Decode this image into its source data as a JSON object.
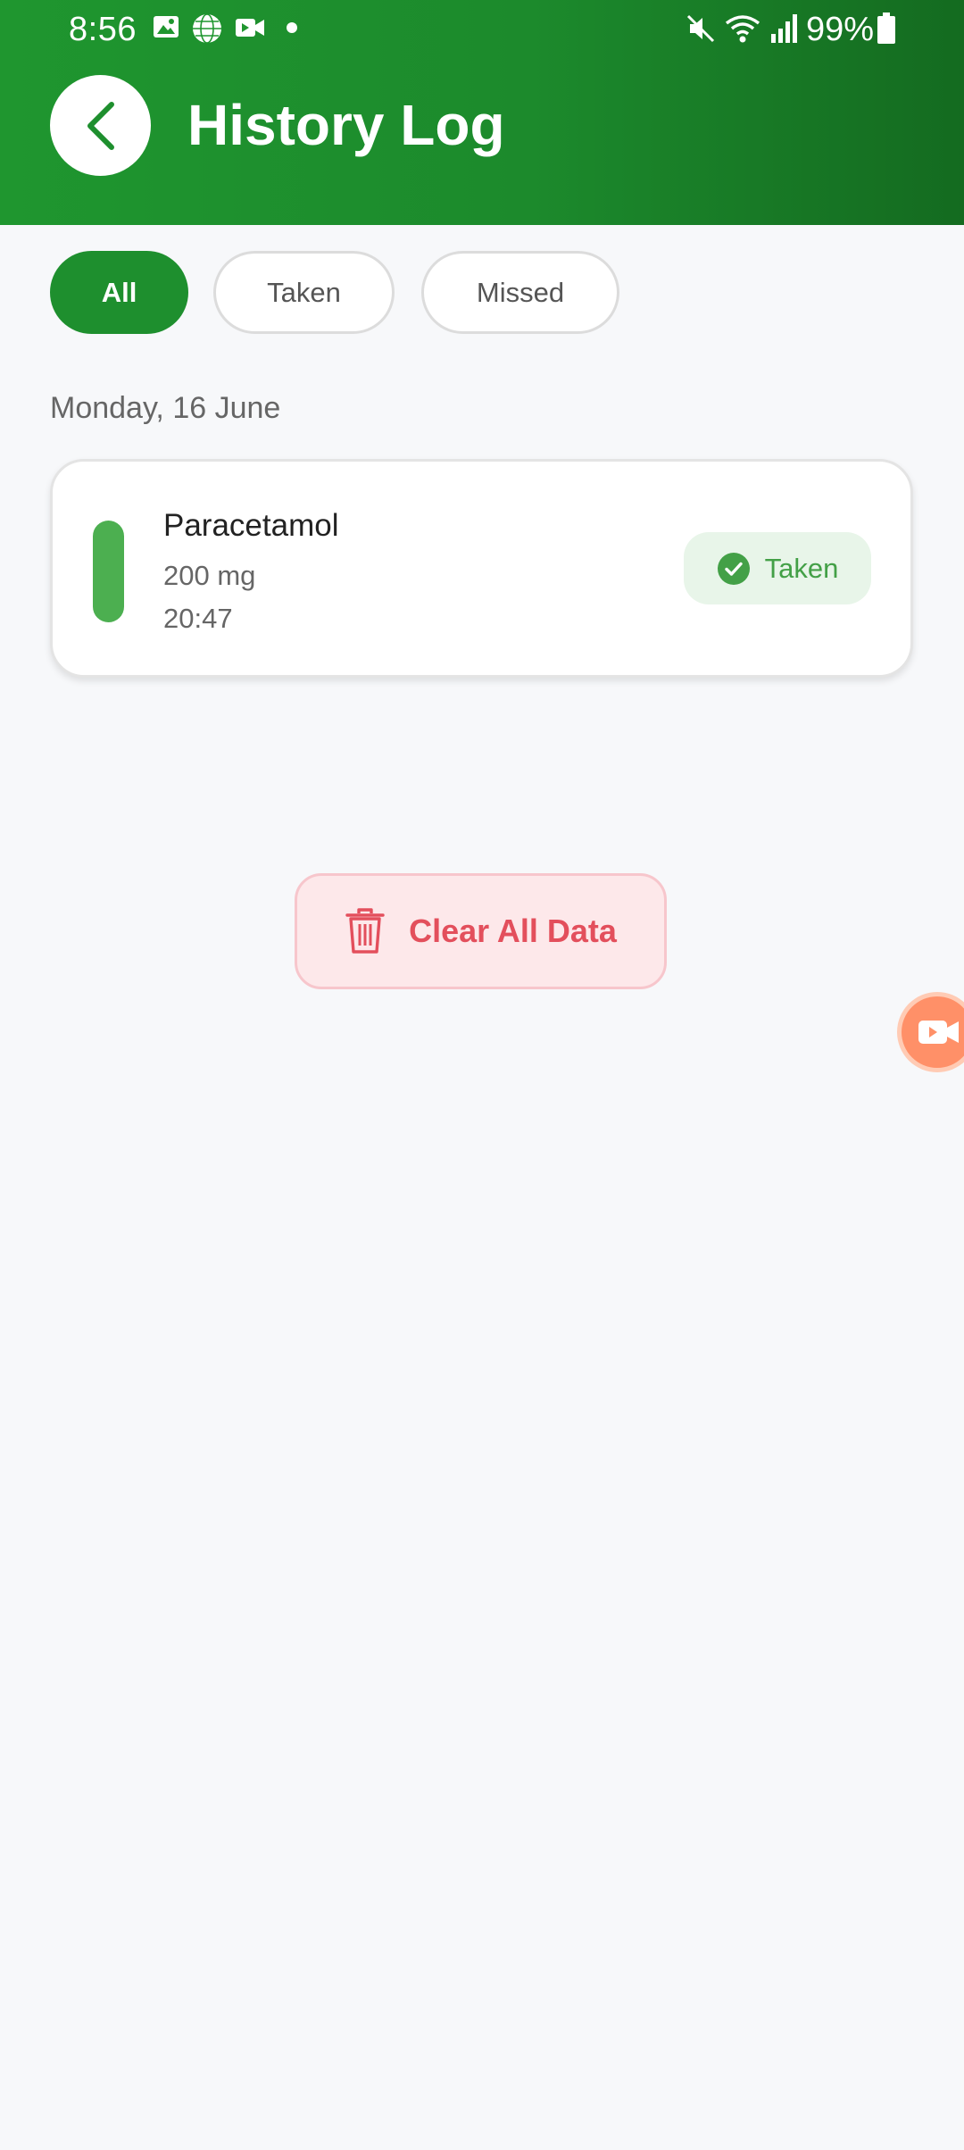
{
  "status_bar": {
    "time": "8:56",
    "battery": "99%",
    "icons": [
      "gallery-icon",
      "globe-icon",
      "video-camera-icon",
      "dot-icon",
      "mute-icon",
      "wifi-icon",
      "signal-icon",
      "battery-icon"
    ]
  },
  "header": {
    "title": "History Log",
    "back_icon": "chevron-left-icon"
  },
  "filters": {
    "selected": "All",
    "options": [
      "All",
      "Taken",
      "Missed"
    ]
  },
  "log": {
    "groups": [
      {
        "date": "Monday, 16 June",
        "entries": [
          {
            "name": "Paracetamol",
            "dose": "200 mg",
            "time": "20:47",
            "status": "Taken",
            "status_icon": "check-circle-icon",
            "status_color": "#4caf50"
          }
        ]
      }
    ]
  },
  "actions": {
    "clear_label": "Clear All Data",
    "clear_icon": "trash-icon",
    "clear_color": "#e34f5c"
  },
  "floating": {
    "icon": "video-recorder-icon"
  },
  "colors": {
    "header_green": "#1e8f2e",
    "background": "#f7f8fa"
  }
}
